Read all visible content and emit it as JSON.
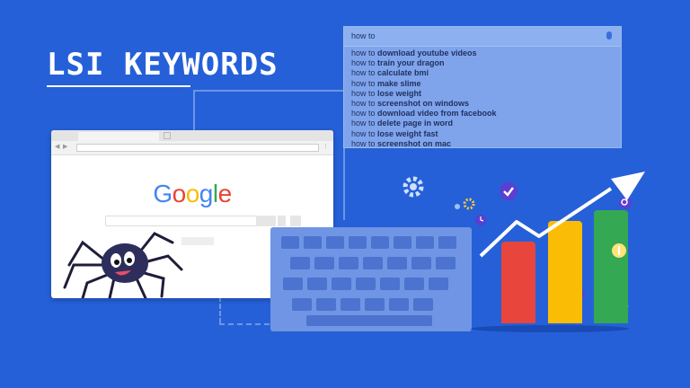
{
  "title": "LSI KEYWORDS",
  "search_box": {
    "value": "how to",
    "suggestions": [
      {
        "prefix": "how to ",
        "term": "download youtube videos"
      },
      {
        "prefix": "how to ",
        "term": "train your dragon"
      },
      {
        "prefix": "how to ",
        "term": "calculate bmi"
      },
      {
        "prefix": "how to ",
        "term": "make slime"
      },
      {
        "prefix": "how to ",
        "term": "lose weight"
      },
      {
        "prefix": "how to ",
        "term": "screenshot on windows"
      },
      {
        "prefix": "how to ",
        "term": "download video from facebook"
      },
      {
        "prefix": "how to ",
        "term": "delete page in word"
      },
      {
        "prefix": "how to ",
        "term": "lose weight fast"
      },
      {
        "prefix": "how to ",
        "term": "screenshot on mac"
      }
    ]
  },
  "browser": {
    "logo": "Google",
    "logo_colors": [
      "#4285F4",
      "#EA4335",
      "#FBBC05",
      "#4285F4",
      "#34A853",
      "#EA4335"
    ]
  },
  "chart": {
    "bar_levels": [
      0.52,
      0.65,
      0.72
    ],
    "bar_colors": [
      "#e8453c",
      "#fbbc05",
      "#34a853"
    ],
    "trend": "up"
  },
  "colors": {
    "background": "#2560d8",
    "panel": "#7fa4ec",
    "keyboard": "#6f95e4"
  }
}
